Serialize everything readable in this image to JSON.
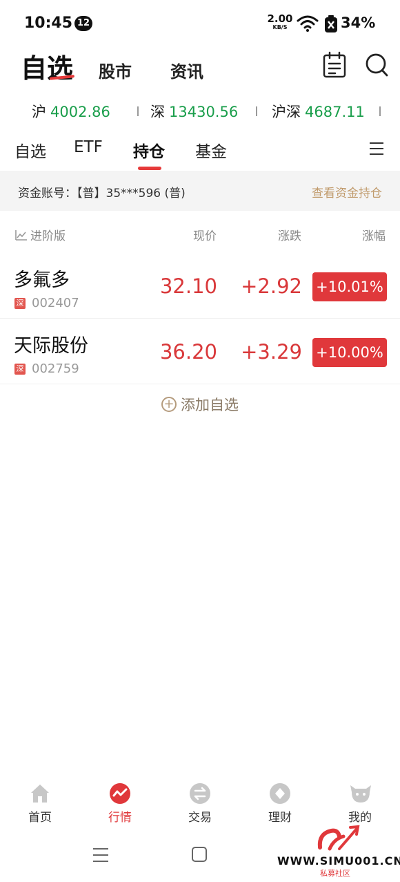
{
  "status_bar": {
    "time": "10:45",
    "notification_count": "12",
    "net_speed": "2.00",
    "net_speed_unit": "KB/S",
    "battery": "34%"
  },
  "header": {
    "logo": "自选",
    "nav": [
      "股市",
      "资讯"
    ],
    "icons": [
      "calendar-note-icon",
      "search-icon"
    ]
  },
  "indices": [
    {
      "name": "沪",
      "value": "4002.86"
    },
    {
      "name": "深",
      "value": "13430.56"
    },
    {
      "name": "沪深",
      "value": "4687.11"
    }
  ],
  "tabs": [
    "自选",
    "ETF",
    "持仓",
    "基金"
  ],
  "active_tab": "持仓",
  "account": {
    "label": "资金账号：【普】35***596 (普)",
    "link": "查看资金持仓"
  },
  "columns": {
    "advanced": "进阶版",
    "price": "现价",
    "change": "涨跌",
    "pct": "涨幅"
  },
  "stocks": [
    {
      "name": "多氟多",
      "market": "深",
      "code": "002407",
      "price": "32.10",
      "change": "+2.92",
      "pct": "+10.01%"
    },
    {
      "name": "天际股份",
      "market": "深",
      "code": "002759",
      "price": "36.20",
      "change": "+3.29",
      "pct": "+10.00%"
    }
  ],
  "add_watchlist": "添加自选",
  "bottom_nav": [
    {
      "label": "首页",
      "icon": "home-icon"
    },
    {
      "label": "行情",
      "icon": "market-icon",
      "active": true
    },
    {
      "label": "交易",
      "icon": "trade-icon"
    },
    {
      "label": "理财",
      "icon": "wealth-icon"
    },
    {
      "label": "我的",
      "icon": "profile-icon"
    }
  ],
  "watermark": {
    "text": "WWW.SIMU001.CN",
    "sub": "私募社区"
  },
  "colors": {
    "up_red": "#d9383a",
    "index_green": "#1a9e4b",
    "accent_gold": "#c09a6b"
  }
}
